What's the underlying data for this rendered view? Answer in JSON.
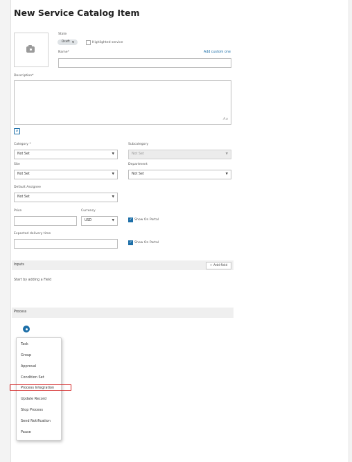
{
  "page": {
    "title": "New Service Catalog Item"
  },
  "form": {
    "state_label": "State",
    "state_value": "Draft",
    "highlighted_label": "Highlighted service",
    "name_label": "Name",
    "add_custom_link": "Add custom one",
    "description_label": "Description",
    "aa_icon": "Aa",
    "category_label": "Category",
    "category_value": "Not Set",
    "subcategory_label": "Subcategory",
    "subcategory_value": "Not Set",
    "site_label": "Site",
    "site_value": "Not Set",
    "department_label": "Department",
    "department_value": "Not Set",
    "default_assignee_label": "Default Assignee",
    "default_assignee_value": "Not Set",
    "price_label": "Price",
    "currency_label": "Currency",
    "currency_value": "USD",
    "show_on_portal_1": "Show On Portal",
    "expected_delivery_label": "Expected delivery time",
    "show_on_portal_2": "Show On Portal",
    "required_mark": "*"
  },
  "inputs_section": {
    "title": "Inputs",
    "add_field_label": "+ Add field",
    "empty_hint": "Start by adding a Field"
  },
  "process_section": {
    "title": "Process",
    "menu_items": [
      "Task",
      "Group",
      "Approval",
      "Condition Set",
      "Process Integration",
      "Update Record",
      "Stop Process",
      "Send Notification",
      "Pause"
    ]
  },
  "icons": {
    "image_placeholder": "camera-icon",
    "attachment": "paperclip-icon",
    "dropdown": "chevron-down-icon",
    "checkbox": "check-icon"
  },
  "colors": {
    "accent": "#1d6fa8",
    "highlight_border": "#d21f1f"
  }
}
